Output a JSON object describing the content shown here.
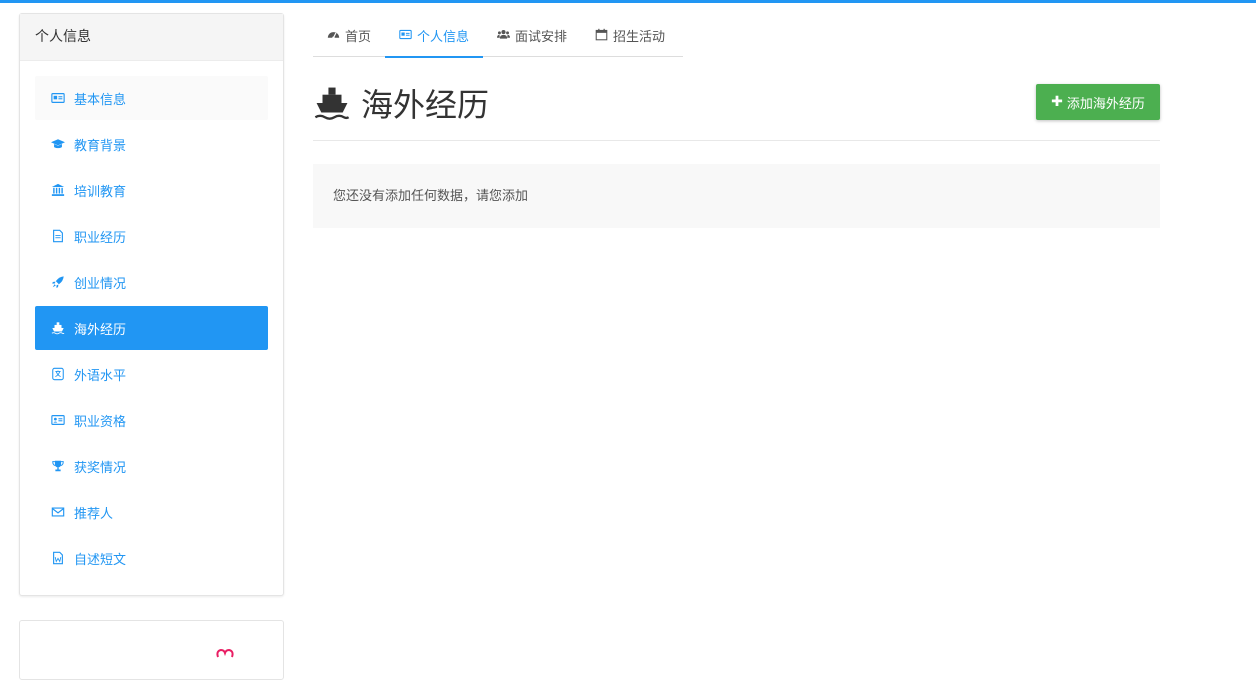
{
  "sidebar": {
    "title": "个人信息",
    "items": [
      {
        "label": "基本信息",
        "icon": "id-card-icon"
      },
      {
        "label": "教育背景",
        "icon": "graduation-cap-icon"
      },
      {
        "label": "培训教育",
        "icon": "institution-icon"
      },
      {
        "label": "职业经历",
        "icon": "document-icon"
      },
      {
        "label": "创业情况",
        "icon": "rocket-icon"
      },
      {
        "label": "海外经历",
        "icon": "ship-icon"
      },
      {
        "label": "外语水平",
        "icon": "language-icon"
      },
      {
        "label": "职业资格",
        "icon": "id-badge-icon"
      },
      {
        "label": "获奖情况",
        "icon": "trophy-icon"
      },
      {
        "label": "推荐人",
        "icon": "envelope-icon"
      },
      {
        "label": "自述短文",
        "icon": "word-file-icon"
      }
    ],
    "active_index": 5
  },
  "tabs": [
    {
      "label": "首页",
      "icon": "dashboard-icon"
    },
    {
      "label": "个人信息",
      "icon": "id-card-icon"
    },
    {
      "label": "面试安排",
      "icon": "users-icon"
    },
    {
      "label": "招生活动",
      "icon": "calendar-icon"
    }
  ],
  "active_tab": 1,
  "main": {
    "title": "海外经历",
    "title_icon": "ship-icon",
    "add_button": "添加海外经历",
    "empty_message": "您还没有添加任何数据，请您添加"
  },
  "colors": {
    "accent": "#2196f3",
    "button": "#4caf50",
    "empty_bg": "#f8f8f8"
  }
}
